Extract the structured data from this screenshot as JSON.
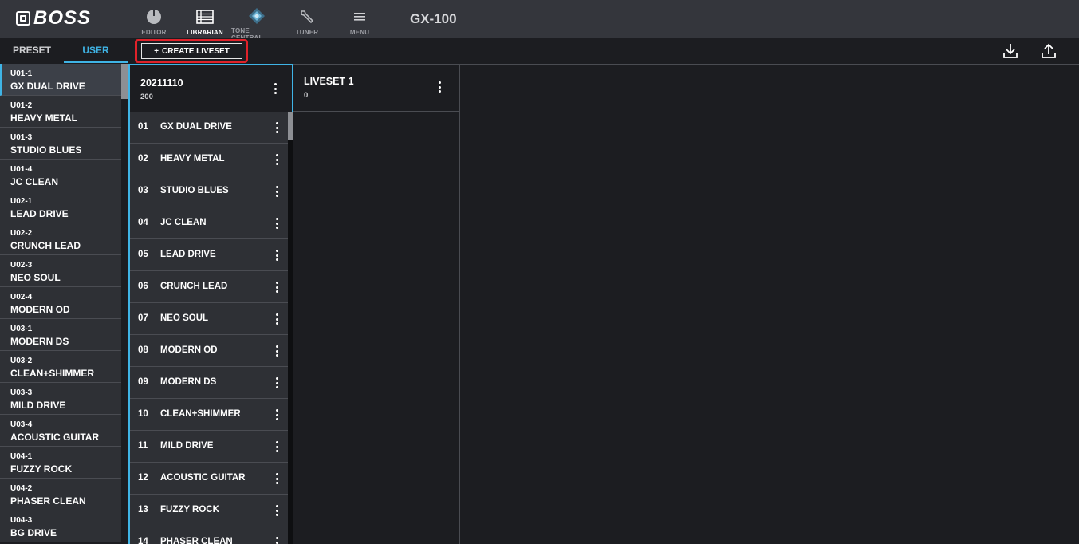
{
  "brand": "BOSS",
  "model": "GX-100",
  "nav": [
    {
      "id": "editor",
      "label": "EDITOR",
      "icon": "editor-knob-icon"
    },
    {
      "id": "librarian",
      "label": "LIBRARIAN",
      "icon": "librarian-list-icon"
    },
    {
      "id": "tone_central",
      "label": "TONE CENTRAL",
      "icon": "tone-central-icon"
    },
    {
      "id": "tuner",
      "label": "TUNER",
      "icon": "tuner-wrench-icon"
    },
    {
      "id": "menu",
      "label": "MENU",
      "icon": "menu-hamburger-icon"
    }
  ],
  "tabs": {
    "preset": "PRESET",
    "user": "USER"
  },
  "user_patches": [
    {
      "code": "U01-1",
      "name": "GX DUAL DRIVE"
    },
    {
      "code": "U01-2",
      "name": "HEAVY METAL"
    },
    {
      "code": "U01-3",
      "name": "STUDIO BLUES"
    },
    {
      "code": "U01-4",
      "name": "JC CLEAN"
    },
    {
      "code": "U02-1",
      "name": "LEAD DRIVE"
    },
    {
      "code": "U02-2",
      "name": "CRUNCH LEAD"
    },
    {
      "code": "U02-3",
      "name": "NEO SOUL"
    },
    {
      "code": "U02-4",
      "name": "MODERN OD"
    },
    {
      "code": "U03-1",
      "name": "MODERN DS"
    },
    {
      "code": "U03-2",
      "name": "CLEAN+SHIMMER"
    },
    {
      "code": "U03-3",
      "name": "MILD DRIVE"
    },
    {
      "code": "U03-4",
      "name": "ACOUSTIC GUITAR"
    },
    {
      "code": "U04-1",
      "name": "FUZZY ROCK"
    },
    {
      "code": "U04-2",
      "name": "PHASER CLEAN"
    },
    {
      "code": "U04-3",
      "name": "BG DRIVE"
    }
  ],
  "toolbar": {
    "create_plus": "+",
    "create_label": "CREATE LIVESET"
  },
  "livesets": [
    {
      "title": "20211110",
      "count": "200"
    },
    {
      "title": "LIVESET 1",
      "count": "0"
    }
  ],
  "liveset_members": [
    {
      "no": "01",
      "name": "GX DUAL DRIVE"
    },
    {
      "no": "02",
      "name": "HEAVY METAL"
    },
    {
      "no": "03",
      "name": "STUDIO BLUES"
    },
    {
      "no": "04",
      "name": "JC CLEAN"
    },
    {
      "no": "05",
      "name": "LEAD DRIVE"
    },
    {
      "no": "06",
      "name": "CRUNCH LEAD"
    },
    {
      "no": "07",
      "name": "NEO SOUL"
    },
    {
      "no": "08",
      "name": "MODERN OD"
    },
    {
      "no": "09",
      "name": "MODERN DS"
    },
    {
      "no": "10",
      "name": "CLEAN+SHIMMER"
    },
    {
      "no": "11",
      "name": "MILD DRIVE"
    },
    {
      "no": "12",
      "name": "ACOUSTIC GUITAR"
    },
    {
      "no": "13",
      "name": "FUZZY ROCK"
    },
    {
      "no": "14",
      "name": "PHASER CLEAN"
    }
  ],
  "colors": {
    "accent": "#3fb4e6",
    "highlight": "#e0222a",
    "panel": "#2e3035",
    "topbar": "#34363c"
  }
}
